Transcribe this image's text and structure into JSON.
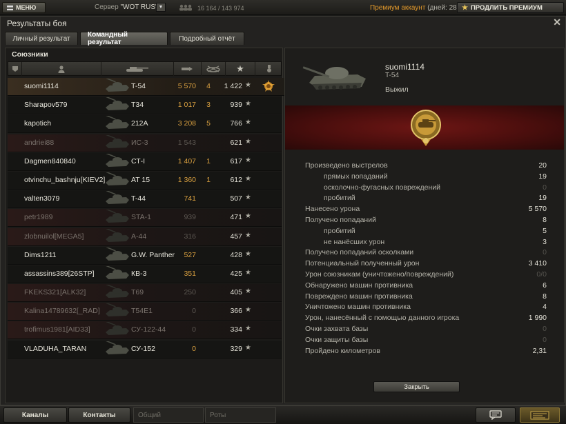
{
  "topbar": {
    "menu_label": "МЕНЮ",
    "server_label": "Сервер",
    "server_value": "\"WOT RUS\"",
    "online_counts": "16 164 / 143 974",
    "premium_label": "Премиум аккаунт",
    "premium_days": "(дней:  28)",
    "extend_label": "ПРОДЛИТЬ ПРЕМИУМ"
  },
  "window": {
    "title": "Результаты боя",
    "close_glyph": "✕",
    "tabs": [
      {
        "label": "Личный результат",
        "active": false
      },
      {
        "label": "Командный результат",
        "active": true
      },
      {
        "label": "Подробный отчёт",
        "active": false
      }
    ]
  },
  "team": {
    "title": "Союзники",
    "players": [
      {
        "name": "suomi1114",
        "tank": "T-54",
        "damage": "5 570",
        "kills": "4",
        "xp": "1 422",
        "self": true,
        "dead": false,
        "medal": true
      },
      {
        "name": "Sharapov579",
        "tank": "T34",
        "damage": "1 017",
        "kills": "3",
        "xp": "939",
        "self": false,
        "dead": false
      },
      {
        "name": "kapotich",
        "tank": "212A",
        "damage": "3 208",
        "kills": "5",
        "xp": "766",
        "self": false,
        "dead": false
      },
      {
        "name": "andriei88",
        "tank": "ИС-3",
        "damage": "1 543",
        "kills": "",
        "xp": "621",
        "self": false,
        "dead": true
      },
      {
        "name": "Dagmen840840",
        "tank": "СТ-I",
        "damage": "1 407",
        "kills": "1",
        "xp": "617",
        "self": false,
        "dead": false
      },
      {
        "name": "otvinchu_bashnju[KIEV2]",
        "tank": "AT 15",
        "damage": "1 360",
        "kills": "1",
        "xp": "612",
        "self": false,
        "dead": false
      },
      {
        "name": "valten3079",
        "tank": "T-44",
        "damage": "741",
        "kills": "",
        "xp": "507",
        "self": false,
        "dead": false
      },
      {
        "name": "petr1989",
        "tank": "STA-1",
        "damage": "939",
        "kills": "",
        "xp": "471",
        "self": false,
        "dead": true
      },
      {
        "name": "zlobnuilol[MEGA5]",
        "tank": "A-44",
        "damage": "316",
        "kills": "",
        "xp": "457",
        "self": false,
        "dead": true
      },
      {
        "name": "Dims1211",
        "tank": "G.W. Panther",
        "damage": "527",
        "kills": "",
        "xp": "428",
        "self": false,
        "dead": false
      },
      {
        "name": "assassins389[26STP]",
        "tank": "КВ-3",
        "damage": "351",
        "kills": "",
        "xp": "425",
        "self": false,
        "dead": false
      },
      {
        "name": "FKEKS321[ALK32]",
        "tank": "T69",
        "damage": "250",
        "kills": "",
        "xp": "405",
        "self": false,
        "dead": true
      },
      {
        "name": "Kalina14789632[_RAD]",
        "tank": "T54E1",
        "damage": "0",
        "kills": "",
        "xp": "366",
        "self": false,
        "dead": true
      },
      {
        "name": "trofimus1981[AID33]",
        "tank": "СУ-122-44",
        "damage": "0",
        "kills": "",
        "xp": "334",
        "self": false,
        "dead": true
      },
      {
        "name": "VLADUHA_TARAN",
        "tank": "СУ-152",
        "damage": "0",
        "kills": "",
        "xp": "329",
        "self": false,
        "dead": false
      }
    ],
    "star_glyph": "★"
  },
  "detail": {
    "player": "suomi1114",
    "tank": "T-54",
    "status": "Выжил",
    "stats": [
      {
        "label": "Произведено выстрелов",
        "value": "20",
        "sub": false,
        "zero": false
      },
      {
        "label": "прямых попаданий",
        "value": "19",
        "sub": true,
        "zero": false
      },
      {
        "label": "осколочно-фугасных повреждений",
        "value": "0",
        "sub": true,
        "zero": true
      },
      {
        "label": "пробитий",
        "value": "19",
        "sub": true,
        "zero": false
      },
      {
        "label": "Нанесено урона",
        "value": "5 570",
        "sub": false,
        "zero": false
      },
      {
        "label": "Получено попаданий",
        "value": "8",
        "sub": false,
        "zero": false
      },
      {
        "label": "пробитий",
        "value": "5",
        "sub": true,
        "zero": false
      },
      {
        "label": "не нанёсших урон",
        "value": "3",
        "sub": true,
        "zero": false
      },
      {
        "label": "Получено попаданий осколками",
        "value": "0",
        "sub": false,
        "zero": true
      },
      {
        "label": "Потенциальный полученный урон",
        "value": "3 410",
        "sub": false,
        "zero": false
      },
      {
        "label": "Урон союзникам (уничтожено/повреждений)",
        "value": "0/0",
        "sub": false,
        "zero": true
      },
      {
        "label": "Обнаружено машин противника",
        "value": "6",
        "sub": false,
        "zero": false
      },
      {
        "label": "Повреждено машин противника",
        "value": "8",
        "sub": false,
        "zero": false
      },
      {
        "label": "Уничтожено машин противника",
        "value": "4",
        "sub": false,
        "zero": false
      },
      {
        "label": "Урон, нанесённый с помощью данного игрока",
        "value": "1 990",
        "sub": false,
        "zero": false
      },
      {
        "label": "Очки захвата базы",
        "value": "0",
        "sub": false,
        "zero": true
      },
      {
        "label": "Очки защиты базы",
        "value": "0",
        "sub": false,
        "zero": true
      },
      {
        "label": "Пройдено километров",
        "value": "2,31",
        "sub": false,
        "zero": false
      }
    ],
    "close_label": "Закрыть"
  },
  "bottombar": {
    "channels_label": "Каналы",
    "contacts_label": "Контакты",
    "general_placeholder": "Общий",
    "companies_placeholder": "Роты"
  },
  "colors": {
    "accent": "#e39a2c",
    "damage": "#d9a040",
    "banner": "#6d1614"
  }
}
